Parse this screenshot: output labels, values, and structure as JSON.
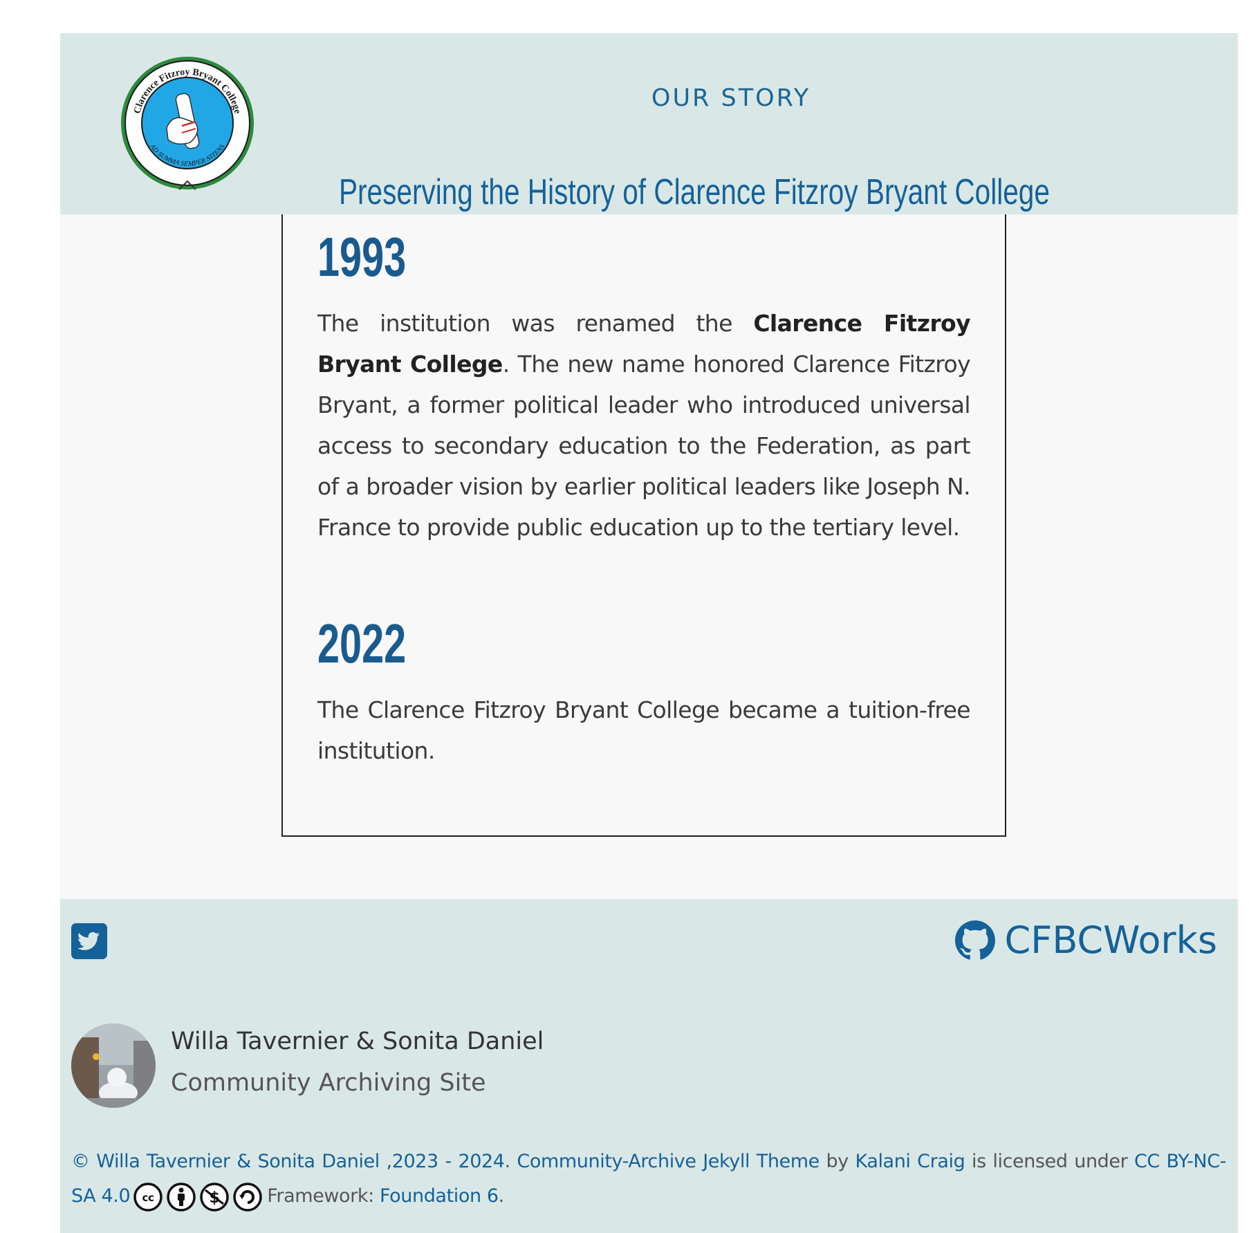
{
  "header": {
    "logo_text_top": "Clarence Fitzroy Bryant College",
    "logo_text_bottom": "AD SUMMA SEMPER NITENS",
    "nav_link": "OUR STORY",
    "site_title": "Preserving the History of Clarence Fitzroy Bryant College"
  },
  "story": {
    "entries": [
      {
        "year": "1993",
        "text_before": "The institution was renamed the ",
        "bold": "Clarence Fitzroy Bryant College",
        "text_after": ". The new name honored Clarence Fitzroy Bryant, a former political leader who introduced universal access to secondary education to the Federation, as part of a broader vision by earlier political leaders like Joseph N. France to provide public education up to the tertiary level."
      },
      {
        "year": "2022",
        "text": "The Clarence Fitzroy Bryant College became a tuition-free institution."
      }
    ]
  },
  "footer": {
    "twitter_icon": "twitter-icon",
    "github_label": "CFBCWorks",
    "author_name": "Willa Tavernier & Sonita Daniel",
    "author_subtitle": "Community Archiving Site",
    "copyright_prefix": "© Willa Tavernier & Sonita Daniel ,2023 - 2024",
    "theme_link": "Community-Archive Jekyll Theme",
    "by_text": " by ",
    "theme_author": "Kalani Craig",
    "licensed_text": " is licensed under ",
    "license_link": "CC BY-NC-SA 4.0",
    "framework_label": "Framework: ",
    "framework_link": "Foundation 6"
  },
  "colors": {
    "header_bg": "#d9e8e6",
    "accent": "#15619a",
    "page_bg": "#f8f8f8"
  }
}
